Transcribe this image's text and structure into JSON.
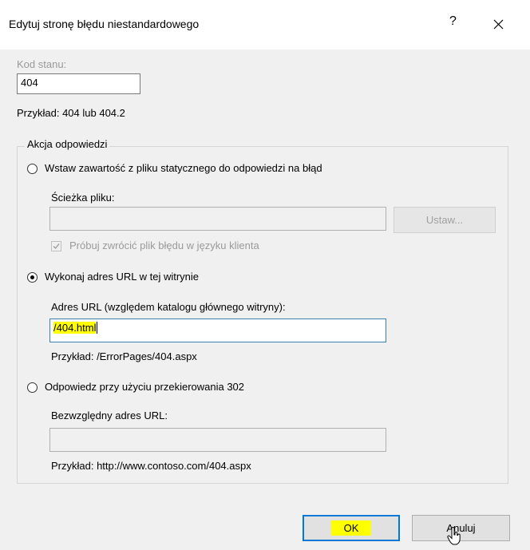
{
  "dialog": {
    "title": "Edytuj stronę błędu niestandardowego",
    "help_glyph": "?",
    "close_glyph": "✕"
  },
  "status": {
    "label": "Kod stanu:",
    "value": "404",
    "example": "Przykład: 404 lub 404.2"
  },
  "group": {
    "legend": "Akcja odpowiedzi",
    "options": [
      {
        "label": "Wstaw zawartość z pliku statycznego do odpowiedzi na błąd",
        "selected": false,
        "field_label": "Ścieżka pliku:",
        "field_value": "",
        "button_label": "Ustaw...",
        "checkbox_label": "Próbuj zwrócić plik błędu w języku klienta",
        "checkbox_checked": true
      },
      {
        "label": "Wykonaj adres URL w tej witrynie",
        "selected": true,
        "field_label": "Adres URL (względem katalogu głównego witryny):",
        "field_value": "/404.html",
        "example": "Przykład: /ErrorPages/404.aspx"
      },
      {
        "label": "Odpowiedz przy użyciu przekierowania 302",
        "selected": false,
        "field_label": "Bezwzględny adres URL:",
        "field_value": "",
        "example": "Przykład: http://www.contoso.com/404.aspx"
      }
    ]
  },
  "buttons": {
    "ok": "OK",
    "cancel": "Anuluj"
  },
  "colors": {
    "highlight": "#ffff00",
    "focus_border": "#0078d7",
    "dialog_bg": "#f0f0f0"
  }
}
